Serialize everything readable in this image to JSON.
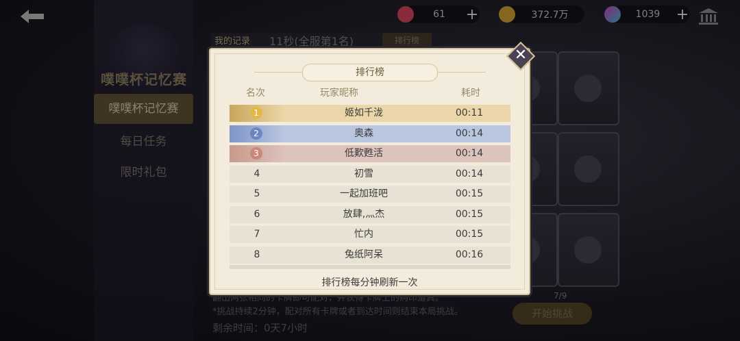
{
  "top_bar": {
    "tickets": {
      "value": "61",
      "icon": "ticket-icon",
      "color": "#e84a6a"
    },
    "gold": {
      "value": "372.7万",
      "icon": "gold-coin-icon",
      "color": "#e6b13a"
    },
    "gems": {
      "value": "1039",
      "icon": "gem-icon",
      "color": "#9a6ae8"
    }
  },
  "sidebar": {
    "logo_title": "噗噗杯记忆赛",
    "items": [
      {
        "label": "噗噗杯记忆赛",
        "active": true
      },
      {
        "label": "每日任务",
        "active": false
      },
      {
        "label": "限时礼包",
        "active": false
      }
    ]
  },
  "record": {
    "tag": "我的记录",
    "value": "11秒(全服第1名)",
    "rank_button": "排行榜"
  },
  "bottom": {
    "rule_line1": "翻出两张相同的卡牌即可配对，并获得卡牌上的购印道具。",
    "rule_line2": "*挑战持续2分钟，配对所有卡牌或者到达时间则结束本局挑战。",
    "remaining": "剩余时间：0天7小时",
    "progress": "7/9",
    "start_button": "开始挑战"
  },
  "modal": {
    "title": "排行榜",
    "headers": {
      "rank": "名次",
      "name": "玩家昵称",
      "time": "耗时"
    },
    "rows": [
      {
        "rank": "1",
        "name": "姬如千泷",
        "time": "00:11"
      },
      {
        "rank": "2",
        "name": "奥森",
        "time": "00:14"
      },
      {
        "rank": "3",
        "name": "低歎甦活",
        "time": "00:14"
      },
      {
        "rank": "4",
        "name": "初雪",
        "time": "00:14"
      },
      {
        "rank": "5",
        "name": "一起加班吧",
        "time": "00:15"
      },
      {
        "rank": "6",
        "name": "放肆,灬杰",
        "time": "00:15"
      },
      {
        "rank": "7",
        "name": "忙内",
        "time": "00:15"
      },
      {
        "rank": "8",
        "name": "兔纸阿呆",
        "time": "00:16"
      }
    ],
    "footer_note": "排行榜每分钟刷新一次"
  }
}
